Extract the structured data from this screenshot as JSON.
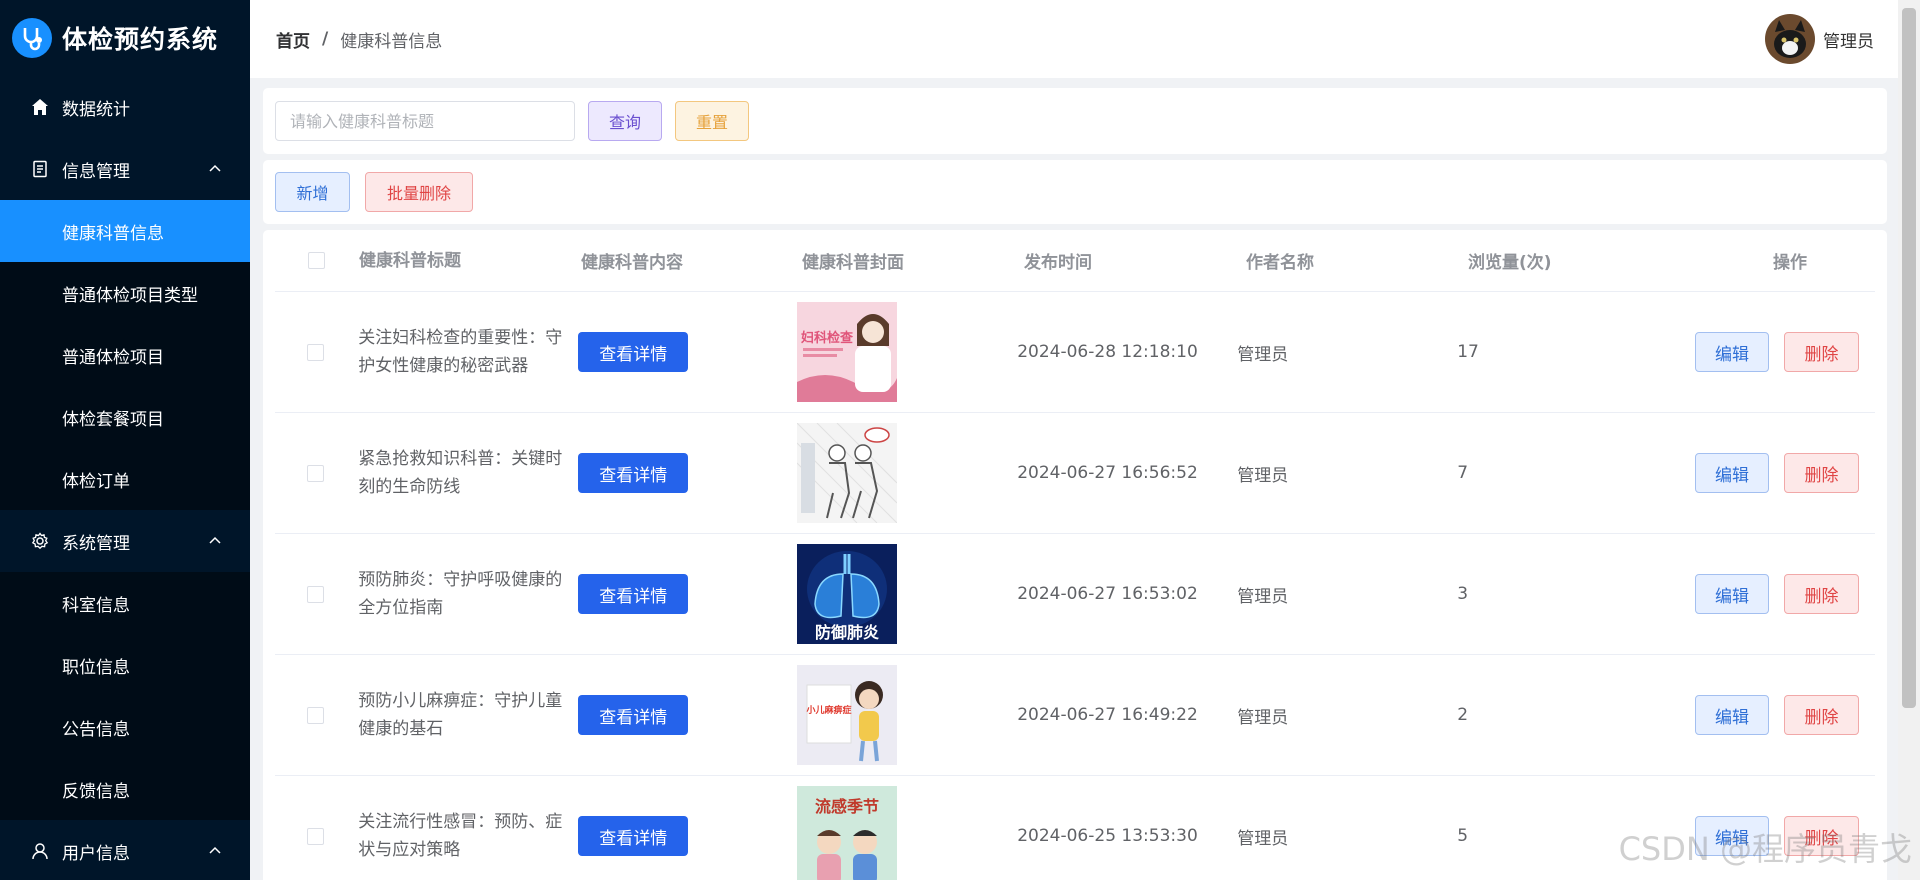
{
  "app": {
    "title": "体检预约系统",
    "accent": "#1890ff",
    "sidebar_bg": "#001529"
  },
  "sidebar": {
    "items": [
      {
        "label": "数据统计",
        "icon": "home-icon",
        "type": "top"
      },
      {
        "label": "信息管理",
        "icon": "document-icon",
        "type": "group",
        "expanded": true
      },
      {
        "label": "健康科普信息",
        "type": "sub",
        "active": true
      },
      {
        "label": "普通体检项目类型",
        "type": "sub"
      },
      {
        "label": "普通体检项目",
        "type": "sub"
      },
      {
        "label": "体检套餐项目",
        "type": "sub"
      },
      {
        "label": "体检订单",
        "type": "sub"
      },
      {
        "label": "系统管理",
        "icon": "gear-icon",
        "type": "group",
        "expanded": true
      },
      {
        "label": "科室信息",
        "type": "sub"
      },
      {
        "label": "职位信息",
        "type": "sub"
      },
      {
        "label": "公告信息",
        "type": "sub"
      },
      {
        "label": "反馈信息",
        "type": "sub"
      },
      {
        "label": "用户信息",
        "icon": "user-icon",
        "type": "group",
        "expanded": true
      }
    ]
  },
  "header": {
    "breadcrumb_home": "首页",
    "breadcrumb_sep": "/",
    "breadcrumb_current": "健康科普信息",
    "user_name": "管理员"
  },
  "search": {
    "placeholder": "请输入健康科普标题",
    "value": "",
    "query_label": "查询",
    "reset_label": "重置"
  },
  "actions": {
    "add_label": "新增",
    "batch_delete_label": "批量删除"
  },
  "table": {
    "columns": [
      "健康科普标题",
      "健康科普内容",
      "健康科普封面",
      "发布时间",
      "作者名称",
      "浏览量(次)",
      "操作"
    ],
    "detail_label": "查看详情",
    "edit_label": "编辑",
    "delete_label": "删除",
    "rows": [
      {
        "title": "关注妇科检查的重要性：守护女性健康的秘密武器",
        "time": "2024-06-28 12:18:10",
        "author": "管理员",
        "views": "17",
        "cover": "gynecology-poster"
      },
      {
        "title": "紧急抢救知识科普：关键时刻的生命防线",
        "time": "2024-06-27 16:56:52",
        "author": "管理员",
        "views": "7",
        "cover": "emergency-rescue-sketch"
      },
      {
        "title": "预防肺炎：守护呼吸健康的全方位指南",
        "time": "2024-06-27 16:53:02",
        "author": "管理员",
        "views": "3",
        "cover": "lungs-poster"
      },
      {
        "title": "预防小儿麻痹症：守护儿童健康的基石",
        "time": "2024-06-27 16:49:22",
        "author": "管理员",
        "views": "2",
        "cover": "polio-poster"
      },
      {
        "title": "关注流行性感冒：预防、症状与应对策略",
        "time": "2024-06-25 13:53:30",
        "author": "管理员",
        "views": "5",
        "cover": "flu-season-poster"
      }
    ],
    "cover_texts": {
      "gynecology": "妇科检查",
      "lungs": "防御肺炎",
      "polio": "小儿麻痹症",
      "flu": "流感季节"
    }
  },
  "watermark": "CSDN @程序员青戈"
}
